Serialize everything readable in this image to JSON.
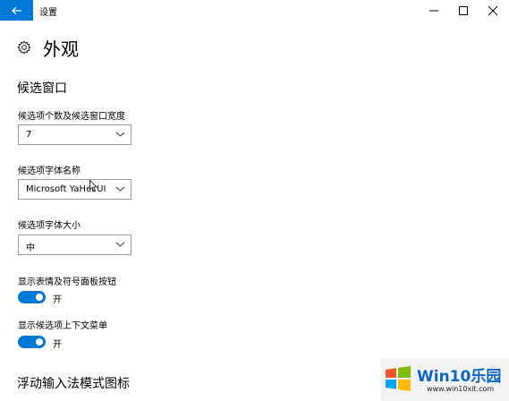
{
  "window": {
    "title": "设置"
  },
  "page": {
    "title": "外观"
  },
  "sections": {
    "candidate_window": "候选窗口",
    "floating_icon": "浮动输入法模式图标"
  },
  "fields": {
    "candidate_count": {
      "label": "候选项个数及候选窗口宽度",
      "value": "7"
    },
    "candidate_font_name": {
      "label": "候选项字体名称",
      "value": "Microsoft YaHei UI"
    },
    "candidate_font_size": {
      "label": "候选项字体大小",
      "value": "中"
    },
    "show_emoji_button": {
      "label": "显示表情及符号面板按钮",
      "state": "开",
      "on": true
    },
    "show_context_menu": {
      "label": "显示候选项上下文菜单",
      "state": "开",
      "on": true
    }
  },
  "watermark": {
    "brand": "Win10乐园",
    "url": "www.win10xit.com"
  },
  "colors": {
    "accent": "#0078d7",
    "border": "#9a9a9a",
    "background": "#ffffff"
  },
  "icons": {
    "back": "back-arrow-icon",
    "settings": "gear-icon",
    "minimize": "minimize-icon",
    "maximize": "maximize-icon",
    "close": "close-icon",
    "dropdown": "chevron-down-icon"
  }
}
